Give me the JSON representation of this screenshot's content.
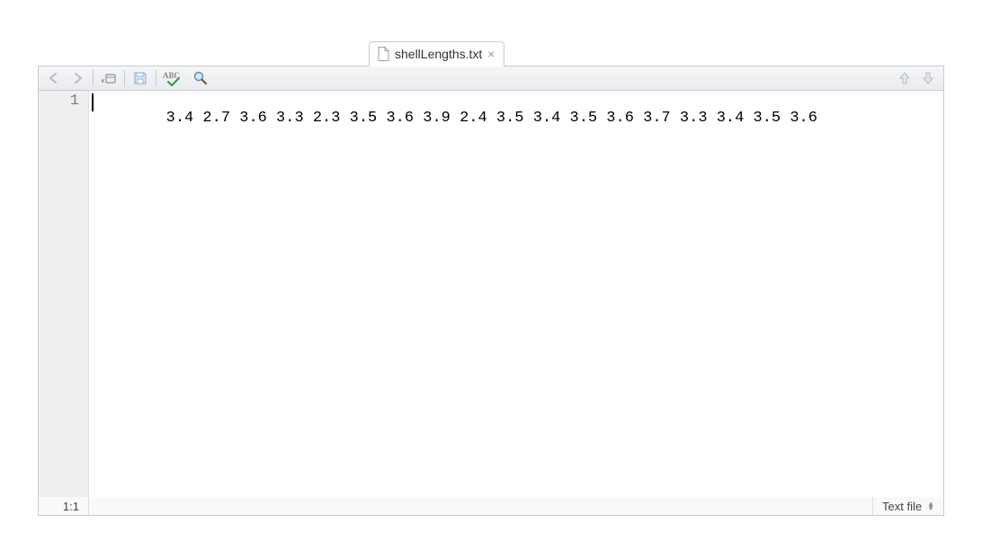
{
  "tab": {
    "filename": "shellLengths.txt",
    "close_tooltip": "Close"
  },
  "toolbar": {
    "back": "Back",
    "forward": "Forward",
    "open_in_window": "Show in new window",
    "save": "Save",
    "spellcheck": "ABC",
    "find": "Find/Replace"
  },
  "editor": {
    "lines": [
      "3.4 2.7 3.6 3.3 2.3 3.5 3.6 3.9 2.4 3.5 3.4 3.5 3.6 3.7 3.3 3.4 3.5 3.6"
    ],
    "line_numbers": [
      "1"
    ]
  },
  "status": {
    "position": "1:1",
    "filetype": "Text file"
  }
}
